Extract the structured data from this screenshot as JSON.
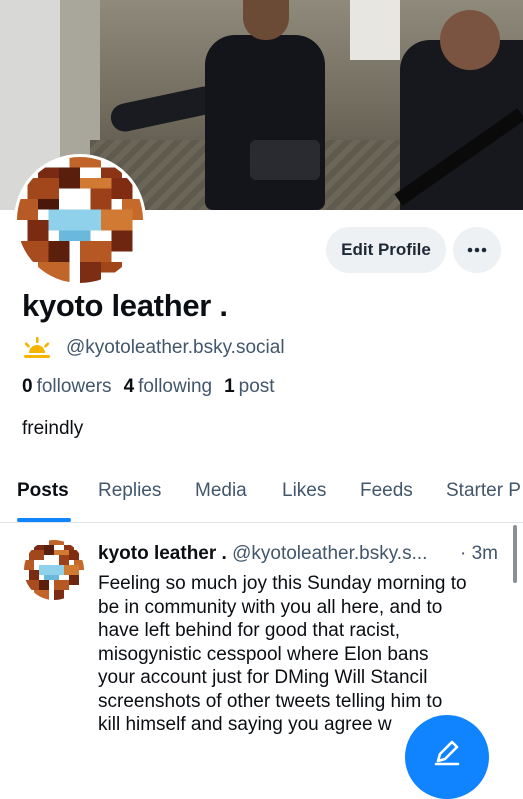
{
  "profile": {
    "display_name": "kyoto leather .",
    "handle": "@kyotoleather.bsky.social",
    "bio": "freindly",
    "stats": {
      "followers_count": "0",
      "followers_label": "followers",
      "following_count": "4",
      "following_label": "following",
      "posts_count": "1",
      "posts_label": "post"
    }
  },
  "actions": {
    "edit_profile_label": "Edit Profile",
    "more_icon": "ellipsis-icon"
  },
  "tabs": [
    {
      "label": "Posts",
      "active": true
    },
    {
      "label": "Replies",
      "active": false
    },
    {
      "label": "Media",
      "active": false
    },
    {
      "label": "Likes",
      "active": false
    },
    {
      "label": "Feeds",
      "active": false
    },
    {
      "label": "Starter P",
      "active": false
    }
  ],
  "post": {
    "author_name": "kyoto leather .",
    "author_handle": "@kyotoleather.bsky.s...",
    "time": "· 3m",
    "lines": [
      "Feeling so much joy this Sunday morning to",
      "be in community with you all here, and to",
      "have left behind for good that racist,",
      "misogynistic cesspool where Elon bans",
      "your account just for DMing Will Stancil",
      "screenshots of other tweets telling him to",
      "kill himself and saying you agree w"
    ]
  },
  "colors": {
    "accent": "#1083fe",
    "muted_text": "#42576c",
    "button_bg": "#eef1f4"
  },
  "icons": {
    "handle_emoji": "sun-emoji-icon",
    "compose": "compose-pencil-icon"
  }
}
